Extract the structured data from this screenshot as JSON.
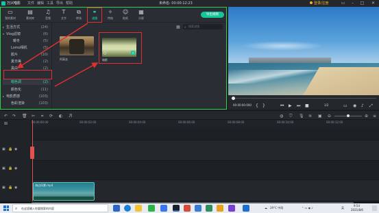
{
  "titlebar": {
    "app_name": "万兴喵影",
    "menus": [
      "文件",
      "编辑",
      "工具",
      "导出",
      "帮助"
    ],
    "project": "未命名: 00:00:12:23",
    "vip_label": "登录/注册"
  },
  "top_tabs": [
    {
      "label": "我的素材",
      "icon": "folder-icon"
    },
    {
      "label": "素材库",
      "icon": "library-icon"
    },
    {
      "label": "音频",
      "icon": "music-icon"
    },
    {
      "label": "文字",
      "icon": "text-icon"
    },
    {
      "label": "转场",
      "icon": "transition-icon"
    },
    {
      "label": "滤镜",
      "icon": "filter-icon"
    },
    {
      "label": "特效",
      "icon": "effects-icon"
    },
    {
      "label": "贴纸",
      "icon": "sticker-icon"
    },
    {
      "label": "分屏",
      "icon": "splitscreen-icon"
    }
  ],
  "export_label": "导出视频",
  "sidebar": [
    {
      "label": "生活方式",
      "count": "(24)",
      "indent": 0
    },
    {
      "label": "Vlog滤镜",
      "count": "(6)",
      "indent": 0
    },
    {
      "label": "暖冬",
      "count": "(5)",
      "indent": 1
    },
    {
      "label": "Lomo相机",
      "count": "(5)",
      "indent": 1
    },
    {
      "label": "胶片",
      "count": "(10)",
      "indent": 1
    },
    {
      "label": "夏日美",
      "count": "(2)",
      "indent": 1
    },
    {
      "label": "黑白",
      "count": "(2)",
      "indent": 1
    },
    {
      "label": "暗色调",
      "count": "(2)",
      "indent": 1,
      "selected": true
    },
    {
      "label": "颜色化",
      "count": "(11)",
      "indent": 1
    },
    {
      "label": "电影质感",
      "count": "(103)",
      "indent": 0
    },
    {
      "label": "色彩渲染",
      "count": "(103)",
      "indent": 1
    }
  ],
  "search_placeholder": "搜索滤镜",
  "thumbnails": [
    {
      "label": "阿离去"
    },
    {
      "label": "暗影"
    }
  ],
  "preview": {
    "timecode": "00:00:00:000",
    "quality": "1/2"
  },
  "ruler_ticks": [
    "00:00:00:00",
    "00:00:02:00",
    "00:00:04:00",
    "00:00:06:00",
    "00:00:08:00",
    "00:00:10:00",
    "00:00:12:00",
    "00:00:14:00",
    "00:00:16:00"
  ],
  "clip_name": "海边风景.mp4",
  "taskbar": {
    "search_placeholder": "在这里输入你要搜索的内容",
    "weather": "29°C 中雨",
    "tray_lang": "英",
    "time": "9:54",
    "date": "2021/8/6"
  }
}
